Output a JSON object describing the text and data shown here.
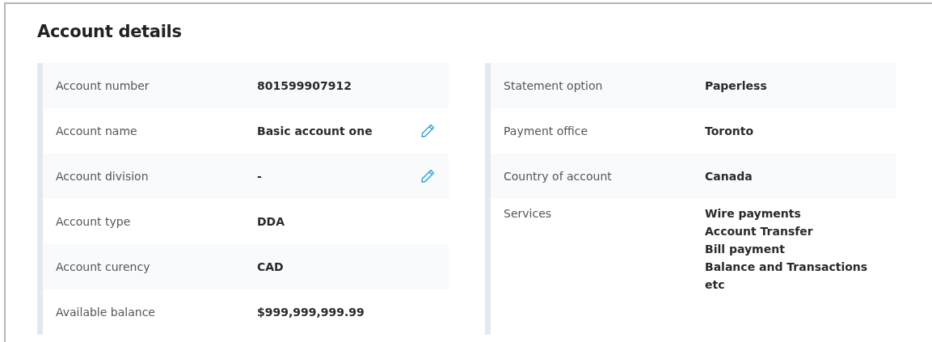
{
  "title": "Account details",
  "panels": [
    {
      "rows": [
        {
          "kind": "text",
          "label": "Account number",
          "value": "801599907912",
          "editable": false
        },
        {
          "kind": "text",
          "label": "Account name",
          "value": "Basic account one",
          "editable": true
        },
        {
          "kind": "text",
          "label": "Account division",
          "value": "-",
          "editable": true
        },
        {
          "kind": "text",
          "label": "Account type",
          "value": "DDA",
          "editable": false
        },
        {
          "kind": "text",
          "label": "Account curency",
          "value": "CAD",
          "editable": false
        },
        {
          "kind": "text",
          "label": "Available balance",
          "value": "$999,999,999.99",
          "editable": false
        }
      ]
    },
    {
      "rows": [
        {
          "kind": "text",
          "label": "Statement option",
          "value": "Paperless",
          "editable": false
        },
        {
          "kind": "text",
          "label": "Payment office",
          "value": "Toronto",
          "editable": false
        },
        {
          "kind": "text",
          "label": "Country of account",
          "value": "Canada",
          "editable": false
        },
        {
          "kind": "list",
          "label": "Services",
          "values": [
            "Wire payments",
            "Account Transfer",
            "Bill payment",
            "Balance and Transactions",
            "etc"
          ],
          "editable": false
        }
      ]
    }
  ]
}
